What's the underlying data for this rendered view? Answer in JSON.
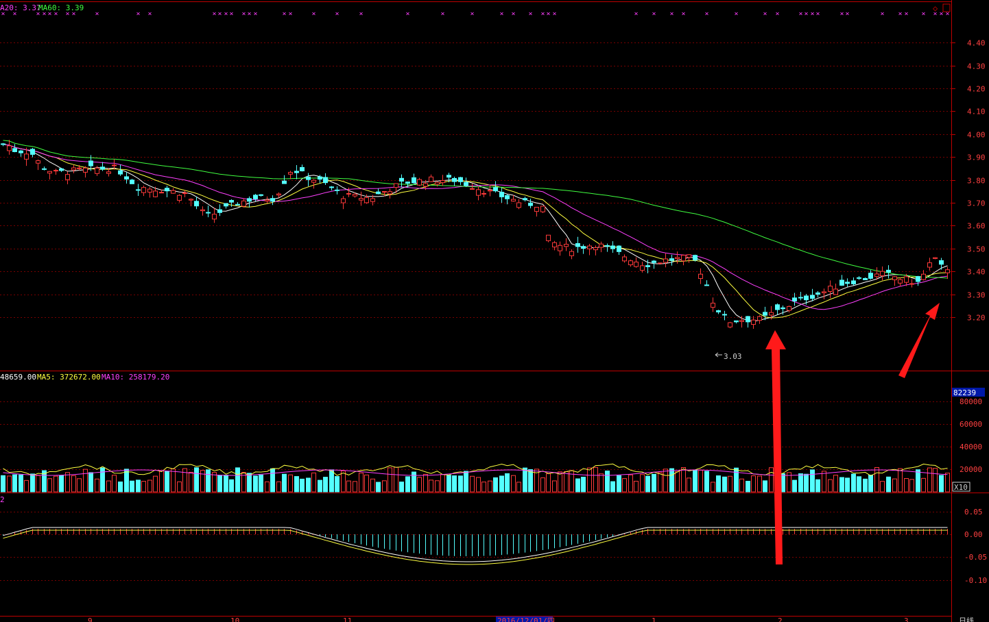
{
  "colors": {
    "background": "#000000",
    "frame": "#c00000",
    "grid": "#7a0000",
    "up": "#ff3a3a",
    "down": "#54ffff",
    "ma5": "#ffffff",
    "ma10": "#ffff40",
    "ma20": "#ff40ff",
    "ma60": "#40ff40",
    "axis_text": "#ff4040",
    "arrow": "#ff1a1a",
    "dea": "#ffff40",
    "volume_badge_bg": "#0018a8"
  },
  "price_panel": {
    "legend": [
      {
        "text": "A20: 3.37",
        "color": "#ff40ff"
      },
      {
        "text": "MA60: 3.39",
        "color": "#40ff40"
      }
    ],
    "low_label": "3.03",
    "y_ticks": [
      "4.40",
      "4.30",
      "4.20",
      "4.10",
      "4.00",
      "3.90",
      "3.80",
      "3.70",
      "3.60",
      "3.50",
      "3.40",
      "3.30",
      "3.20"
    ],
    "top_right_icons": [
      "diamond-icon",
      "square-icon"
    ]
  },
  "volume_panel": {
    "legend": [
      {
        "text": "48659.00",
        "color": "#ffffff"
      },
      {
        "text": "MA5: 372672.00",
        "color": "#ffff40"
      },
      {
        "text": "MA10: 258179.20",
        "color": "#ff40ff"
      }
    ],
    "current_badge": "82239",
    "y_ticks": [
      "80000",
      "60000",
      "40000",
      "20000"
    ],
    "multiplier": "X10"
  },
  "macd_panel": {
    "legend": "2",
    "y_ticks": [
      "0.05",
      "0.00",
      "-0.05",
      "-0.10"
    ]
  },
  "x_axis": {
    "labels": [
      "9",
      "10",
      "11",
      "2016/12/01/四",
      "1",
      "2",
      "3"
    ],
    "period": "日线"
  }
}
